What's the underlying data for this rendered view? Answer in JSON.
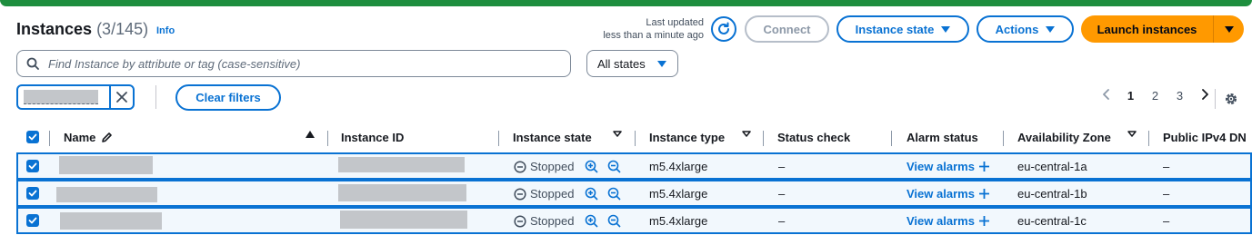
{
  "header": {
    "title": "Instances",
    "count": "(3/145)",
    "info_label": "Info",
    "last_updated_line1": "Last updated",
    "last_updated_line2": "less than a minute ago"
  },
  "toolbar": {
    "connect_label": "Connect",
    "instance_state_label": "Instance state",
    "actions_label": "Actions",
    "launch_label": "Launch instances"
  },
  "search": {
    "placeholder": "Find Instance by attribute or tag (case-sensitive)",
    "value": ""
  },
  "state_filter": {
    "selected": "All states"
  },
  "filters": {
    "clear_label": "Clear filters"
  },
  "pagination": {
    "pages": [
      "1",
      "2",
      "3"
    ],
    "current": "1"
  },
  "table": {
    "columns": {
      "name": "Name",
      "instance_id": "Instance ID",
      "instance_state": "Instance state",
      "instance_type": "Instance type",
      "status_check": "Status check",
      "alarm_status": "Alarm status",
      "availability_zone": "Availability Zone",
      "public_ipv4": "Public IPv4 DN"
    },
    "rows": [
      {
        "state": "Stopped",
        "type": "m5.4xlarge",
        "status_check": "–",
        "alarm": "View alarms",
        "zone": "eu-central-1a",
        "public_ip": "–"
      },
      {
        "state": "Stopped",
        "type": "m5.4xlarge",
        "status_check": "–",
        "alarm": "View alarms",
        "zone": "eu-central-1b",
        "public_ip": "–"
      },
      {
        "state": "Stopped",
        "type": "m5.4xlarge",
        "status_check": "–",
        "alarm": "View alarms",
        "zone": "eu-central-1c",
        "public_ip": "–"
      }
    ]
  },
  "colors": {
    "accent": "#0972d3",
    "primary_button": "#ff9900",
    "selected_row_bg": "#f2f8fd",
    "top_strip": "#1e8e3e"
  },
  "icons": [
    "refresh-icon",
    "search-icon",
    "close-icon",
    "caret-down-icon",
    "chevron-left-icon",
    "chevron-right-icon",
    "settings-gear-icon",
    "edit-pencil-icon",
    "sort-up-icon",
    "filter-caret-icon",
    "stopped-icon",
    "zoom-in-icon",
    "zoom-out-icon",
    "plus-icon",
    "check-icon"
  ]
}
